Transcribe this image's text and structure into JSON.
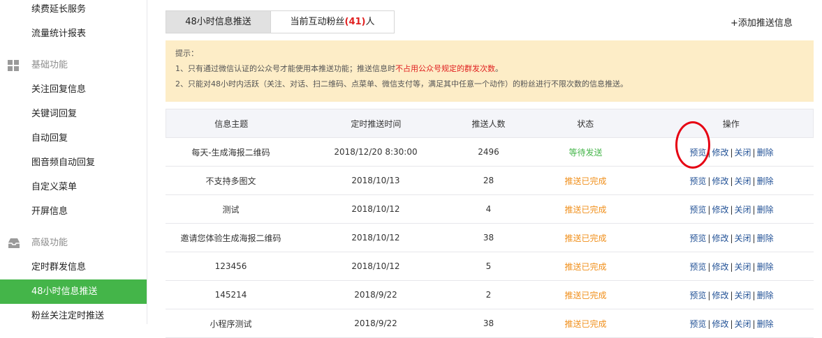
{
  "sidebar": {
    "items": [
      {
        "label": "续费延长服务"
      },
      {
        "label": "流量统计报表"
      }
    ],
    "group_basic": {
      "label": "基础功能",
      "icon": "grid-icon"
    },
    "basic_items": [
      {
        "label": "关注回复信息"
      },
      {
        "label": "关键词回复"
      },
      {
        "label": "自动回复"
      },
      {
        "label": "图音频自动回复"
      },
      {
        "label": "自定义菜单"
      },
      {
        "label": "开屏信息"
      }
    ],
    "group_advanced": {
      "label": "高级功能",
      "icon": "inbox-icon"
    },
    "advanced_items": [
      {
        "label": "定时群发信息"
      },
      {
        "label": "48小时信息推送",
        "active": true
      },
      {
        "label": "粉丝关注定时推送"
      }
    ]
  },
  "tabs": {
    "tab1": "48小时信息推送",
    "tab2_prefix": "当前互动粉丝",
    "tab2_count": "(41)",
    "tab2_suffix": "人"
  },
  "add_link": "+添加推送信息",
  "notice": {
    "title": "提示：",
    "line1_a": "1、只有通过微信认证的公众号才能使用本推送功能；推送信息时",
    "line1_b": "不占用公众号规定的群发次数",
    "line1_c": "。",
    "line2": "2、只能对48小时内活跃（关注、对话、扫二维码、点菜单、微信支付等，满足其中任意一个动作）的粉丝进行不限次数的信息推送。"
  },
  "table": {
    "headers": [
      "信息主题",
      "定时推送时间",
      "推送人数",
      "状态",
      "操作"
    ],
    "rows": [
      {
        "topic": "每天-生成海报二维码",
        "time": "2018/12/20 8:30:00",
        "count": "2496",
        "status": "等待发送",
        "status_type": "waiting"
      },
      {
        "topic": "不支持多图文",
        "time": "2018/10/13",
        "count": "28",
        "status": "推送已完成",
        "status_type": "done"
      },
      {
        "topic": "测试",
        "time": "2018/10/12",
        "count": "4",
        "status": "推送已完成",
        "status_type": "done"
      },
      {
        "topic": "邀请您体验生成海报二维码",
        "time": "2018/10/12",
        "count": "38",
        "status": "推送已完成",
        "status_type": "done"
      },
      {
        "topic": "123456",
        "time": "2018/10/12",
        "count": "5",
        "status": "推送已完成",
        "status_type": "done"
      },
      {
        "topic": "145214",
        "time": "2018/9/22",
        "count": "2",
        "status": "推送已完成",
        "status_type": "done"
      },
      {
        "topic": "小程序测试",
        "time": "2018/9/22",
        "count": "38",
        "status": "推送已完成",
        "status_type": "done"
      }
    ],
    "ops": {
      "preview": "预览",
      "edit": "修改",
      "close": "关闭",
      "delete": "删除",
      "separator": "|"
    }
  },
  "colors": {
    "accent_green": "#44b549",
    "status_done": "#f08f1b",
    "highlight_red": "#e02020",
    "annotation_circle": "#e60012"
  }
}
